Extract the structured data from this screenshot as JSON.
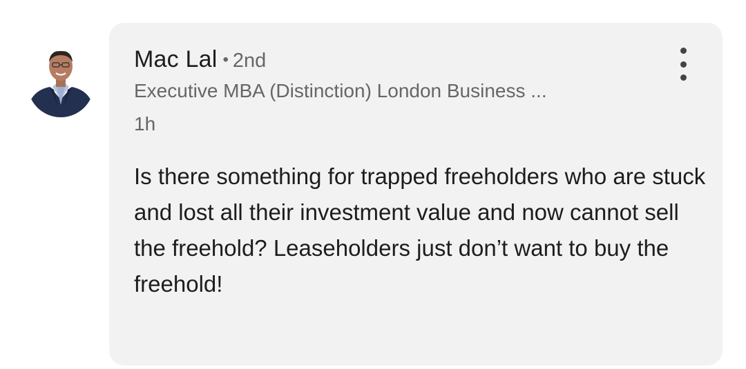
{
  "comment": {
    "author": {
      "name": "Mac Lal",
      "separator": "•",
      "degree": "2nd",
      "headline": "Executive MBA (Distinction) London Business ...",
      "avatar_icon": "profile-photo"
    },
    "timestamp": "1h",
    "text": "Is there something for trapped freeholders who are stuck and lost all their investment value and now cannot sell the freehold? Leaseholders just don’t want to buy the freehold!",
    "menu_icon": "more-vertical-icon"
  },
  "colors": {
    "bubble_background": "#f2f2f2",
    "primary_text": "#1d1d1d",
    "secondary_text": "#666666"
  }
}
